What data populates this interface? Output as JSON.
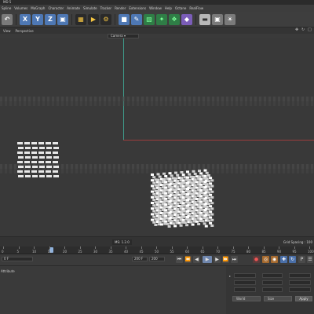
{
  "window": {
    "title": "MD 5"
  },
  "menubar": {
    "items": [
      "Spline",
      "Volumes",
      "MoGraph",
      "Character",
      "Animate",
      "Simulate",
      "Tracker",
      "Render",
      "Extensions",
      "Window",
      "Help",
      "Octane",
      "RealFlow"
    ]
  },
  "toolbar": {
    "buttons": [
      {
        "name": "undo-icon",
        "glyph": "↶",
        "style": "grey"
      },
      {
        "name": "x-axis-icon",
        "glyph": "X",
        "style": "blue"
      },
      {
        "name": "y-axis-icon",
        "glyph": "Y",
        "style": "blue"
      },
      {
        "name": "z-axis-icon",
        "glyph": "Z",
        "style": "blue"
      },
      {
        "name": "coordinate-system-icon",
        "glyph": "▣",
        "style": "blue"
      },
      {
        "name": "render-region-icon",
        "glyph": "▦",
        "style": "dark"
      },
      {
        "name": "render-view-icon",
        "glyph": "▶",
        "style": "dark"
      },
      {
        "name": "render-settings-icon",
        "glyph": "⚙",
        "style": "dark"
      },
      {
        "name": "cube-icon",
        "glyph": "■",
        "style": "blue"
      },
      {
        "name": "pen-icon",
        "glyph": "✎",
        "style": "blue"
      },
      {
        "name": "subdivision-icon",
        "glyph": "▧",
        "style": "green"
      },
      {
        "name": "array-icon",
        "glyph": "✦",
        "style": "green"
      },
      {
        "name": "cloner-icon",
        "glyph": "❖",
        "style": "green"
      },
      {
        "name": "deformer-icon",
        "glyph": "◆",
        "style": "purple"
      },
      {
        "name": "floor-icon",
        "glyph": "▬",
        "style": "lgrey"
      },
      {
        "name": "camera-icon",
        "glyph": "▣",
        "style": "grey"
      },
      {
        "name": "light-icon",
        "glyph": "☀",
        "style": "grey"
      }
    ]
  },
  "viewport_header": {
    "items": [
      "View",
      "Perspective"
    ]
  },
  "viewport": {
    "camera_label": "Camera ▾"
  },
  "status": {
    "frame": "MS: 1.2.0",
    "grid": "Grid Spacing : 100"
  },
  "timeline": {
    "labels": [
      "0",
      "5",
      "10",
      "15",
      "20",
      "25",
      "30",
      "35",
      "40",
      "45",
      "50",
      "55",
      "60",
      "65",
      "70",
      "75",
      "80",
      "85",
      "90",
      "95",
      "100"
    ]
  },
  "controls": {
    "start": "0 F",
    "end": "200 F",
    "end2": "200"
  },
  "bottom": {
    "left_label": "Attribute"
  },
  "coords": {
    "dropdown_left": "World",
    "dropdown_right": "Size",
    "apply": "Apply"
  }
}
